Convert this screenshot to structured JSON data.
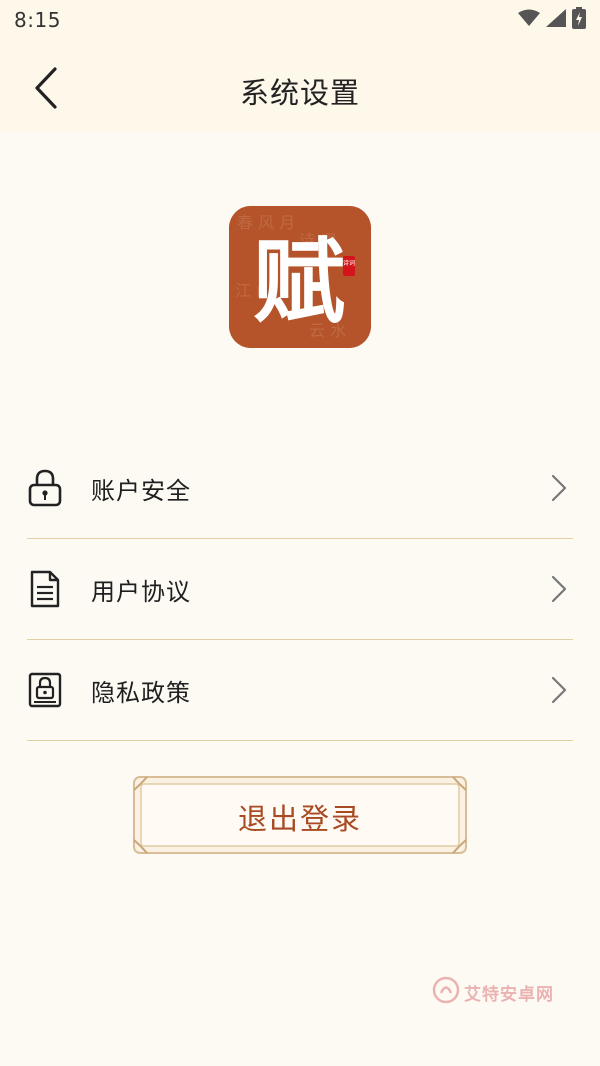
{
  "status_bar": {
    "time": "8:15",
    "icons": [
      "wifi-icon",
      "signal-icon",
      "battery-charging-icon"
    ]
  },
  "header": {
    "title": "系统设置",
    "back_icon": "chevron-left-icon"
  },
  "logo": {
    "character": "赋",
    "seal_text": "诗词",
    "background_color": "#b5542b"
  },
  "menu": {
    "items": [
      {
        "label": "账户安全",
        "icon": "lock-icon"
      },
      {
        "label": "用户协议",
        "icon": "document-icon"
      },
      {
        "label": "隐私政策",
        "icon": "privacy-lock-icon"
      }
    ]
  },
  "logout": {
    "label": "退出登录"
  },
  "watermark": {
    "text": "艾特安卓网"
  },
  "colors": {
    "accent": "#a84a22",
    "divider": "#e3cfa4",
    "header_bg": "#fdf8ea",
    "page_bg": "#fdfaf4"
  }
}
